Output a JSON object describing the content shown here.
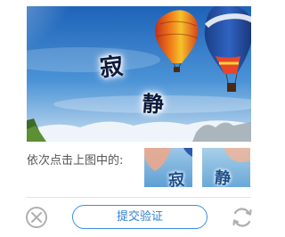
{
  "captcha": {
    "characters": [
      "寂",
      "静"
    ],
    "instruction": "依次点击上图中的:",
    "submit_label": "提交验证"
  },
  "icons": {
    "close": "close-circle-icon",
    "refresh": "refresh-icon"
  },
  "colors": {
    "accent": "#3a8ee6",
    "icon_gray": "#b0b0b0",
    "text": "#555555"
  }
}
